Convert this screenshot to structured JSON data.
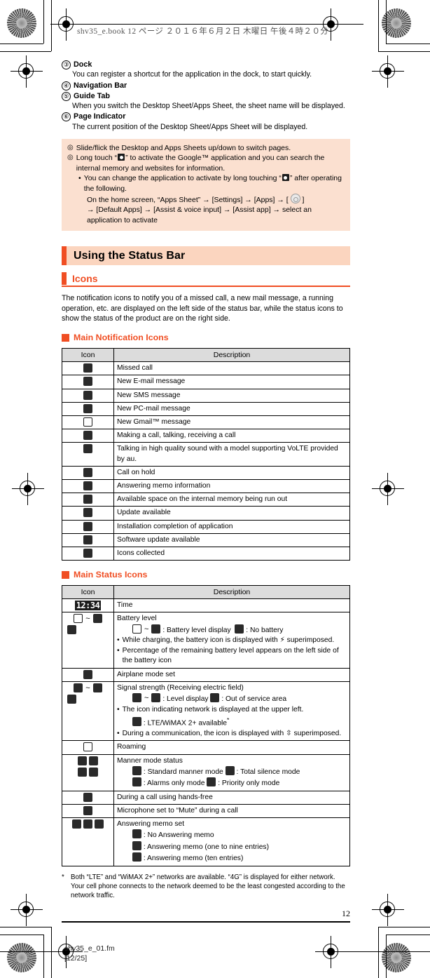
{
  "page_header": {
    "text": "shv35_e.book   12 ページ   ２０１６年６月２日   木曜日   午後４時２０分"
  },
  "numbered_items": [
    {
      "num": "③",
      "title": "Dock",
      "body": "You can register a shortcut for the application in the dock, to start quickly."
    },
    {
      "num": "④",
      "title": "Navigation Bar",
      "body": ""
    },
    {
      "num": "⑤",
      "title": "Guide Tab",
      "body": "When you switch the Desktop Sheet/Apps Sheet, the sheet name will be displayed."
    },
    {
      "num": "⑥",
      "title": "Page Indicator",
      "body": "The current position of the Desktop Sheet/Apps Sheet will be displayed."
    }
  ],
  "note_box": {
    "bullet_glyph": "◎",
    "line1": "Slide/flick the Desktop and Apps Sheets up/down to switch pages.",
    "line2_a": "Long touch “",
    "line2_b": "” to activate the Google™ application and you can search the internal memory and websites for information.",
    "sub_bullet": "•",
    "sub1_a": "You can change the application to activate by long touching “",
    "sub1_b": "” after operating the following.",
    "sub2_a": "On the home screen, “Apps Sheet” → [Settings] → [Apps] → [ ",
    "sub2_b": " ]",
    "sub3": "→ [Default Apps] → [Assist & voice input] → [Assist app] → select an application to activate"
  },
  "section": {
    "h1": "Using the Status Bar",
    "h2": "Icons",
    "intro": "The notification icons to notify you of a missed call, a new mail message, a running operation, etc. are displayed on the left side of the status bar, while the status icons to show the status of the product are on the right side.",
    "h3_notification": "Main Notification Icons",
    "h3_status": "Main Status Icons"
  },
  "table_headers": {
    "icon": "Icon",
    "description": "Description"
  },
  "notification_rows": [
    {
      "icon": "missed-call-icon",
      "desc": "Missed call"
    },
    {
      "icon": "new-email-icon",
      "desc": "New E-mail message"
    },
    {
      "icon": "new-sms-icon",
      "desc": "New SMS message"
    },
    {
      "icon": "new-pcmail-icon",
      "desc": "New PC-mail message"
    },
    {
      "icon": "new-gmail-icon",
      "desc": "New Gmail™ message"
    },
    {
      "icon": "calling-icon",
      "desc": "Making a call, talking, receiving a call"
    },
    {
      "icon": "volte-call-icon",
      "desc": "Talking in high quality sound with a model supporting VoLTE provided by au."
    },
    {
      "icon": "call-hold-icon",
      "desc": "Call on hold"
    },
    {
      "icon": "answering-memo-info-icon",
      "desc": "Answering memo information"
    },
    {
      "icon": "storage-low-icon",
      "desc": "Available space on the internal memory being run out"
    },
    {
      "icon": "update-available-icon",
      "desc": "Update available"
    },
    {
      "icon": "install-complete-icon",
      "desc": "Installation completion of application"
    },
    {
      "icon": "software-update-icon",
      "desc": "Software update available"
    },
    {
      "icon": "icons-collected-icon",
      "desc": "Icons collected"
    }
  ],
  "status_rows": {
    "time": {
      "icon_text": "12:34",
      "desc": "Time"
    },
    "battery": {
      "title": "Battery level",
      "detail_a": "~",
      "detail_b": ": Battery level display",
      "detail_c": ": No battery",
      "bullet1": "While charging, the battery icon is displayed with",
      "bullet1_end": "superimposed.",
      "bullet2": "Percentage of the remaining battery level appears on the left side of the battery icon"
    },
    "airplane": {
      "desc": "Airplane mode set"
    },
    "signal": {
      "title": "Signal strength (Receiving electric field)",
      "detail_a": "~",
      "detail_b": ": Level display",
      "detail_c": ": Out of service area",
      "bullet1": "The icon indicating network is displayed at the upper left.",
      "bullet1_sub": ": LTE/WiMAX 2+ available",
      "bullet1_sub_mark": "*",
      "bullet2": "During a communication, the icon is displayed with",
      "bullet2_end": "superimposed."
    },
    "roaming": {
      "desc": "Roaming"
    },
    "manner": {
      "title": "Manner mode status",
      "d1": ": Standard manner mode",
      "d2": ": Total silence mode",
      "d3": ": Alarms only mode",
      "d4": ": Priority only mode"
    },
    "handsfree": {
      "desc": "During a call using hands-free"
    },
    "mute": {
      "desc": "Microphone set to “Mute” during a call"
    },
    "answering_memo": {
      "title": "Answering memo set",
      "d1": ": No Answering memo",
      "d2": ": Answering memo (one to nine entries)",
      "d3": ": Answering memo (ten entries)"
    }
  },
  "footnote": {
    "mark": "*",
    "text": "Both “LTE” and “WiMAX 2+” networks are available. “4G” is displayed for either network. Your cell phone connects to the network deemed to be the least congested according to the network traffic."
  },
  "page_number": "12",
  "footer": {
    "filename": "shv35_e_01.fm",
    "pages": "[12/25]"
  },
  "colors": {
    "accent": "#f04e23",
    "band": "#fbd5bf",
    "note_bg": "#fbe0d0",
    "header_cell": "#dcdcdc"
  }
}
